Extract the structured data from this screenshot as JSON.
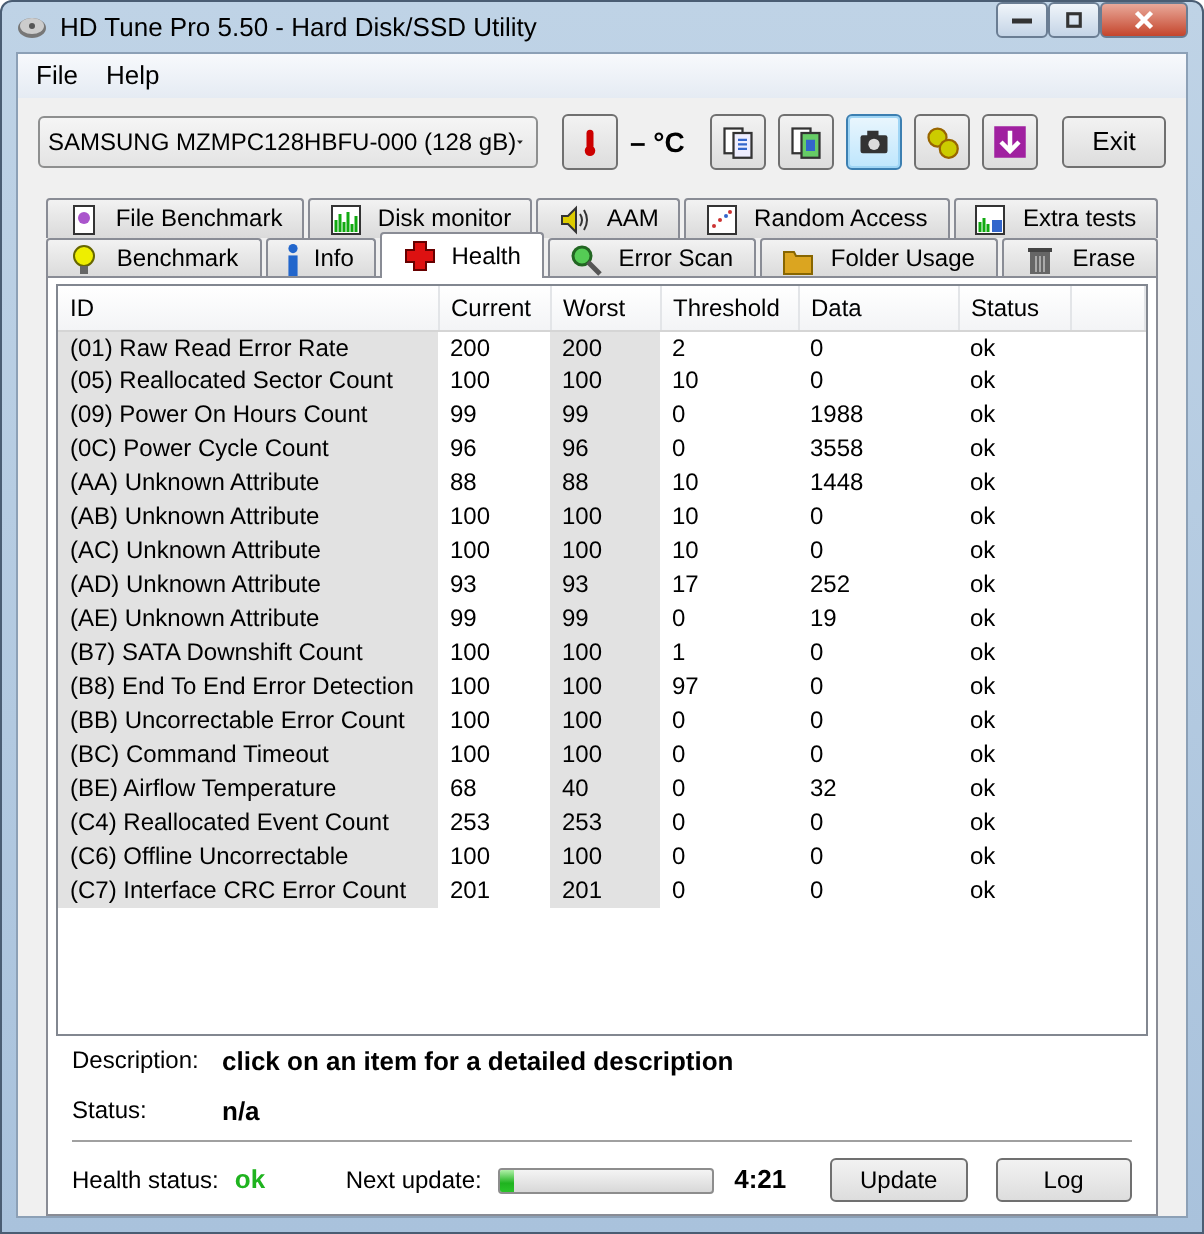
{
  "window": {
    "title": "HD Tune Pro 5.50 - Hard Disk/SSD Utility"
  },
  "menu": [
    "File",
    "Help"
  ],
  "toolbar": {
    "device": "SAMSUNG MZMPC128HBFU-000 (128 gB)",
    "temperature": "– °C",
    "tool_buttons": [
      {
        "focused": false
      },
      {
        "focused": false
      },
      {
        "focused": true
      },
      {
        "focused": false
      },
      {
        "focused": false
      }
    ],
    "exit": "Exit"
  },
  "tabs_back": [
    {
      "label": "File Benchmark",
      "selected": false
    },
    {
      "label": "Disk monitor",
      "selected": false
    },
    {
      "label": "AAM",
      "selected": false
    },
    {
      "label": "Random Access",
      "selected": false
    },
    {
      "label": "Extra tests",
      "selected": false
    }
  ],
  "tabs_front": [
    {
      "label": "Benchmark",
      "selected": false
    },
    {
      "label": "Info",
      "selected": false
    },
    {
      "label": "Health",
      "selected": true
    },
    {
      "label": "Error Scan",
      "selected": false
    },
    {
      "label": "Folder Usage",
      "selected": false
    },
    {
      "label": "Erase",
      "selected": false
    }
  ],
  "table": {
    "columns": [
      "ID",
      "Current",
      "Worst",
      "Threshold",
      "Data",
      "Status"
    ],
    "rows": [
      [
        "(01) Raw Read Error Rate",
        "200",
        "200",
        "2",
        "0",
        "ok"
      ],
      [
        "(05) Reallocated Sector Count",
        "100",
        "100",
        "10",
        "0",
        "ok"
      ],
      [
        "(09) Power On Hours Count",
        "99",
        "99",
        "0",
        "1988",
        "ok"
      ],
      [
        "(0C) Power Cycle Count",
        "96",
        "96",
        "0",
        "3558",
        "ok"
      ],
      [
        "(AA) Unknown Attribute",
        "88",
        "88",
        "10",
        "1448",
        "ok"
      ],
      [
        "(AB) Unknown Attribute",
        "100",
        "100",
        "10",
        "0",
        "ok"
      ],
      [
        "(AC) Unknown Attribute",
        "100",
        "100",
        "10",
        "0",
        "ok"
      ],
      [
        "(AD) Unknown Attribute",
        "93",
        "93",
        "17",
        "252",
        "ok"
      ],
      [
        "(AE) Unknown Attribute",
        "99",
        "99",
        "0",
        "19",
        "ok"
      ],
      [
        "(B7) SATA Downshift Count",
        "100",
        "100",
        "1",
        "0",
        "ok"
      ],
      [
        "(B8) End To End Error Detection",
        "100",
        "100",
        "97",
        "0",
        "ok"
      ],
      [
        "(BB) Uncorrectable Error Count",
        "100",
        "100",
        "0",
        "0",
        "ok"
      ],
      [
        "(BC) Command Timeout",
        "100",
        "100",
        "0",
        "0",
        "ok"
      ],
      [
        "(BE) Airflow Temperature",
        "68",
        "40",
        "0",
        "32",
        "ok"
      ],
      [
        "(C4) Reallocated Event Count",
        "253",
        "253",
        "0",
        "0",
        "ok"
      ],
      [
        "(C6) Offline Uncorrectable",
        "100",
        "100",
        "0",
        "0",
        "ok"
      ],
      [
        "(C7) Interface CRC Error Count",
        "201",
        "201",
        "0",
        "0",
        "ok"
      ]
    ]
  },
  "details": {
    "description_label": "Description:",
    "description": "click on an item for a detailed description",
    "status_label": "Status:",
    "status": "n/a"
  },
  "footer": {
    "health_label": "Health status:",
    "health": "ok",
    "next_update_label": "Next update:",
    "level": 0.07,
    "time": "4:21",
    "buttons": [
      "Update",
      "Log"
    ]
  }
}
